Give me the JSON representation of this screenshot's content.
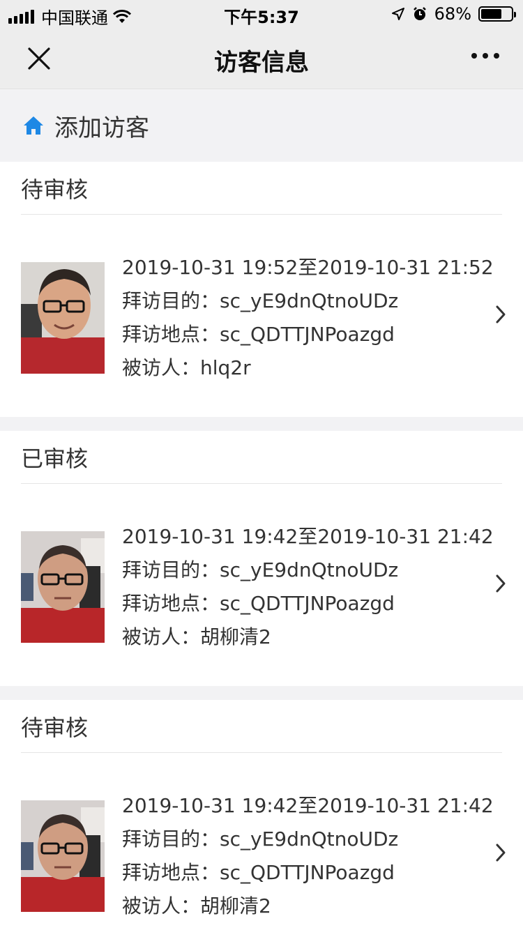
{
  "status": {
    "carrier": "中国联通",
    "time": "下午5:37",
    "battery": "68%",
    "battery_level": 0.68
  },
  "nav": {
    "title": "访客信息"
  },
  "add_visitor": {
    "label": "添加访客"
  },
  "labels": {
    "purpose": "拜访目的：",
    "location": "拜访地点：",
    "host": "被访人："
  },
  "visits": [
    {
      "status": "待审核",
      "time_range": "2019-10-31 19:52至2019-10-31 21:52",
      "purpose": "sc_yE9dnQtnoUDz",
      "location": "sc_QDTTJNPoazgd",
      "host": "hlq2r"
    },
    {
      "status": "已审核",
      "time_range": "2019-10-31 19:42至2019-10-31 21:42",
      "purpose": "sc_yE9dnQtnoUDz",
      "location": "sc_QDTTJNPoazgd",
      "host": "胡柳清2"
    },
    {
      "status": "待审核",
      "time_range": "2019-10-31 19:42至2019-10-31 21:42",
      "purpose": "sc_yE9dnQtnoUDz",
      "location": "sc_QDTTJNPoazgd",
      "host": "胡柳清2"
    }
  ],
  "colors": {
    "home_icon": "#1e88e5",
    "background": "#f2f2f4",
    "nav_background": "#ededed"
  }
}
